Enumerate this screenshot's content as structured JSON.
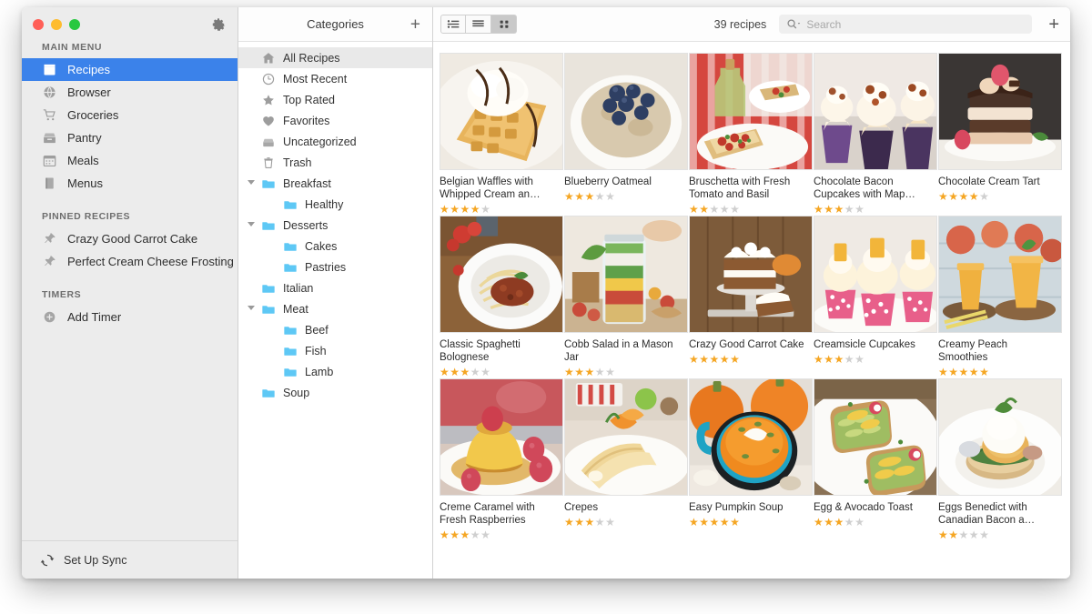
{
  "window": {
    "traffic_lights": [
      "close",
      "minimize",
      "zoom"
    ],
    "gear_label": "Preferences"
  },
  "sidebar": {
    "sections": [
      {
        "title": "MAIN MENU",
        "items": [
          {
            "label": "Recipes",
            "icon": "recipe-box-icon",
            "selected": true
          },
          {
            "label": "Browser",
            "icon": "globe-icon",
            "selected": false
          },
          {
            "label": "Groceries",
            "icon": "cart-icon",
            "selected": false
          },
          {
            "label": "Pantry",
            "icon": "pantry-icon",
            "selected": false
          },
          {
            "label": "Meals",
            "icon": "calendar-icon",
            "selected": false
          },
          {
            "label": "Menus",
            "icon": "menu-book-icon",
            "selected": false
          }
        ]
      },
      {
        "title": "PINNED RECIPES",
        "items": [
          {
            "label": "Crazy Good Carrot Cake",
            "icon": "pin-icon",
            "selected": false
          },
          {
            "label": "Perfect Cream Cheese Frosting",
            "icon": "pin-icon",
            "selected": false
          }
        ]
      },
      {
        "title": "TIMERS",
        "items": [
          {
            "label": "Add Timer",
            "icon": "plus-circle-icon",
            "selected": false
          }
        ]
      }
    ],
    "footer": {
      "label": "Set Up Sync",
      "icon": "sync-icon"
    }
  },
  "categories": {
    "header_title": "Categories",
    "add_label": "+",
    "items": [
      {
        "label": "All Recipes",
        "icon": "home-icon",
        "active": true,
        "indent": false,
        "twisty": "none"
      },
      {
        "label": "Most Recent",
        "icon": "clock-icon",
        "active": false,
        "indent": false,
        "twisty": "none"
      },
      {
        "label": "Top Rated",
        "icon": "star-icon",
        "active": false,
        "indent": false,
        "twisty": "none"
      },
      {
        "label": "Favorites",
        "icon": "heart-icon",
        "active": false,
        "indent": false,
        "twisty": "none"
      },
      {
        "label": "Uncategorized",
        "icon": "inbox-icon",
        "active": false,
        "indent": false,
        "twisty": "none"
      },
      {
        "label": "Trash",
        "icon": "trash-icon",
        "active": false,
        "indent": false,
        "twisty": "none"
      },
      {
        "label": "Breakfast",
        "icon": "folder-icon",
        "active": false,
        "indent": false,
        "twisty": "open"
      },
      {
        "label": "Healthy",
        "icon": "folder-icon",
        "active": false,
        "indent": true,
        "twisty": "none"
      },
      {
        "label": "Desserts",
        "icon": "folder-icon",
        "active": false,
        "indent": false,
        "twisty": "open"
      },
      {
        "label": "Cakes",
        "icon": "folder-icon",
        "active": false,
        "indent": true,
        "twisty": "none"
      },
      {
        "label": "Pastries",
        "icon": "folder-icon",
        "active": false,
        "indent": true,
        "twisty": "none"
      },
      {
        "label": "Italian",
        "icon": "folder-icon",
        "active": false,
        "indent": false,
        "twisty": "none"
      },
      {
        "label": "Meat",
        "icon": "folder-icon",
        "active": false,
        "indent": false,
        "twisty": "open"
      },
      {
        "label": "Beef",
        "icon": "folder-icon",
        "active": false,
        "indent": true,
        "twisty": "none"
      },
      {
        "label": "Fish",
        "icon": "folder-icon",
        "active": false,
        "indent": true,
        "twisty": "none"
      },
      {
        "label": "Lamb",
        "icon": "folder-icon",
        "active": false,
        "indent": true,
        "twisty": "none"
      },
      {
        "label": "Soup",
        "icon": "folder-icon",
        "active": false,
        "indent": false,
        "twisty": "none"
      }
    ]
  },
  "toolbar": {
    "views": [
      {
        "name": "list-detail-view",
        "active": false
      },
      {
        "name": "list-view",
        "active": false
      },
      {
        "name": "grid-view",
        "active": true
      }
    ],
    "recipe_count": "39 recipes",
    "search_placeholder": "Search",
    "search_value": "",
    "add_label": "+"
  },
  "recipes": [
    {
      "title": "Belgian Waffles with Whipped Cream an…",
      "rating": 4,
      "image": "belgian-waffles"
    },
    {
      "title": "Blueberry Oatmeal",
      "rating": 3,
      "image": "blueberry-oatmeal"
    },
    {
      "title": "Bruschetta with Fresh Tomato and Basil",
      "rating": 2,
      "image": "bruschetta"
    },
    {
      "title": "Chocolate Bacon Cupcakes with Map…",
      "rating": 3,
      "image": "chocolate-bacon-cupcakes"
    },
    {
      "title": "Chocolate Cream Tart",
      "rating": 4,
      "image": "chocolate-cream-tart"
    },
    {
      "title": "Classic Spaghetti Bolognese",
      "rating": 3,
      "image": "spaghetti-bolognese"
    },
    {
      "title": "Cobb Salad in a Mason Jar",
      "rating": 3,
      "image": "cobb-salad-jar"
    },
    {
      "title": "Crazy Good Carrot Cake",
      "rating": 5,
      "image": "carrot-cake"
    },
    {
      "title": "Creamsicle Cupcakes",
      "rating": 3,
      "image": "creamsicle-cupcakes"
    },
    {
      "title": "Creamy Peach Smoothies",
      "rating": 5,
      "image": "peach-smoothies"
    },
    {
      "title": "Creme Caramel with Fresh Raspberries",
      "rating": 3,
      "image": "creme-caramel"
    },
    {
      "title": "Crepes",
      "rating": 3,
      "image": "crepes"
    },
    {
      "title": "Easy Pumpkin Soup",
      "rating": 5,
      "image": "pumpkin-soup"
    },
    {
      "title": "Egg & Avocado Toast",
      "rating": 3,
      "image": "avocado-toast"
    },
    {
      "title": "Eggs Benedict with Canadian Bacon a…",
      "rating": 2,
      "image": "eggs-benedict"
    }
  ],
  "colors": {
    "accent": "#3b82ea",
    "star_on": "#f5a623",
    "star_off": "#cfcfcf",
    "sidebar_bg": "#ececec",
    "folder_blue": "#5ec8f5"
  }
}
